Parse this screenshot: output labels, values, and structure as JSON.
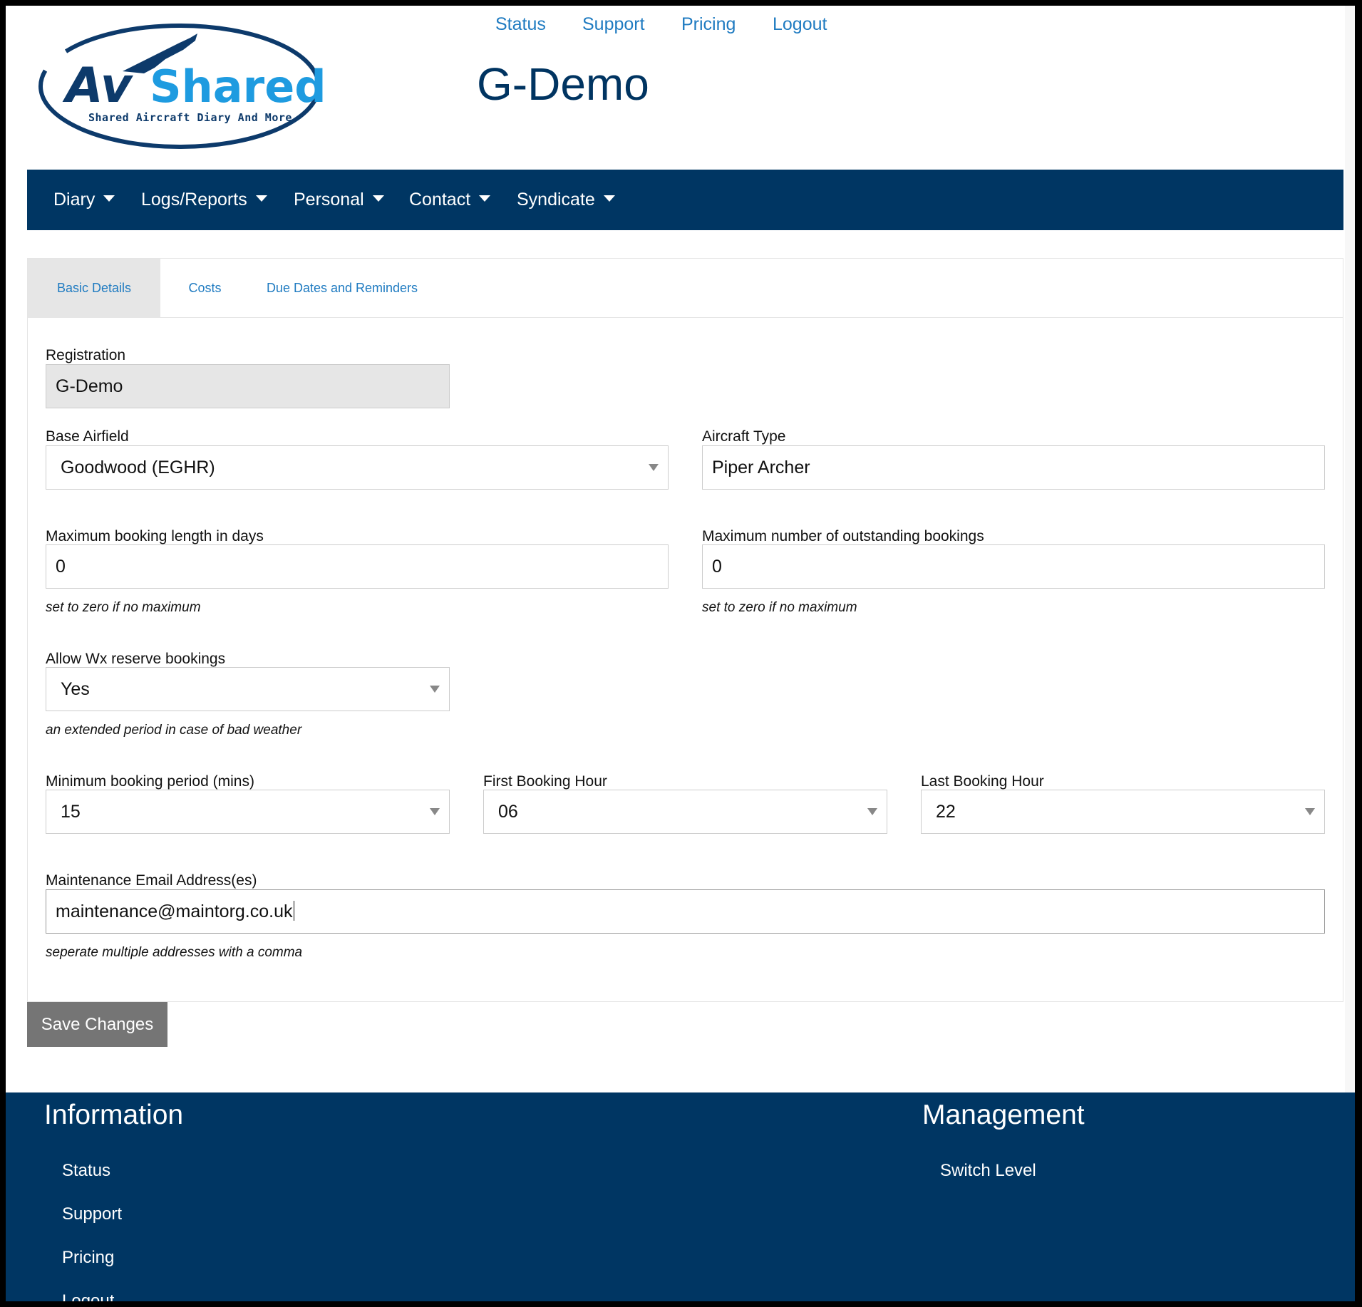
{
  "brand": {
    "logo_main_prefix": "Av",
    "logo_main_suffix": "Shared",
    "logo_tagline": "Shared Aircraft Diary And More",
    "colors": {
      "navy": "#003663",
      "link_blue": "#1f7bc1",
      "logo_light_blue": "#1e9be0"
    }
  },
  "header": {
    "top_links": [
      "Status",
      "Support",
      "Pricing",
      "Logout"
    ],
    "title": "G-Demo"
  },
  "navbar": {
    "items": [
      {
        "label": "Diary",
        "icon": "caret-down-icon"
      },
      {
        "label": "Logs/Reports",
        "icon": "caret-down-icon"
      },
      {
        "label": "Personal",
        "icon": "caret-down-icon"
      },
      {
        "label": "Contact",
        "icon": "caret-down-icon"
      },
      {
        "label": "Syndicate",
        "icon": "caret-down-icon"
      }
    ]
  },
  "tabs": [
    {
      "label": "Basic Details",
      "active": true
    },
    {
      "label": "Costs",
      "active": false
    },
    {
      "label": "Due Dates and Reminders",
      "active": false
    }
  ],
  "form": {
    "registration": {
      "label": "Registration",
      "value": "G-Demo",
      "readonly": true
    },
    "base_airfield": {
      "label": "Base Airfield",
      "value": "Goodwood (EGHR)"
    },
    "aircraft_type": {
      "label": "Aircraft Type",
      "value": "Piper Archer"
    },
    "max_booking_length": {
      "label": "Maximum booking length in days",
      "value": "0",
      "help": "set to zero if no maximum"
    },
    "max_outstanding": {
      "label": "Maximum number of outstanding bookings",
      "value": "0",
      "help": "set to zero if no maximum"
    },
    "allow_wx": {
      "label": "Allow Wx reserve bookings",
      "value": "Yes",
      "help": "an extended period in case of bad weather"
    },
    "min_booking_period": {
      "label": "Minimum booking period (mins)",
      "value": "15"
    },
    "first_booking_hour": {
      "label": "First Booking Hour",
      "value": "06"
    },
    "last_booking_hour": {
      "label": "Last Booking Hour",
      "value": "22"
    },
    "maintenance_email": {
      "label": "Maintenance Email Address(es)",
      "value": "maintenance@maintorg.co.uk",
      "help": "seperate multiple addresses with a comma"
    },
    "save_label": "Save Changes"
  },
  "footer": {
    "information": {
      "heading": "Information",
      "links": [
        "Status",
        "Support",
        "Pricing",
        "Logout"
      ]
    },
    "management": {
      "heading": "Management",
      "links": [
        "Switch Level"
      ]
    }
  }
}
